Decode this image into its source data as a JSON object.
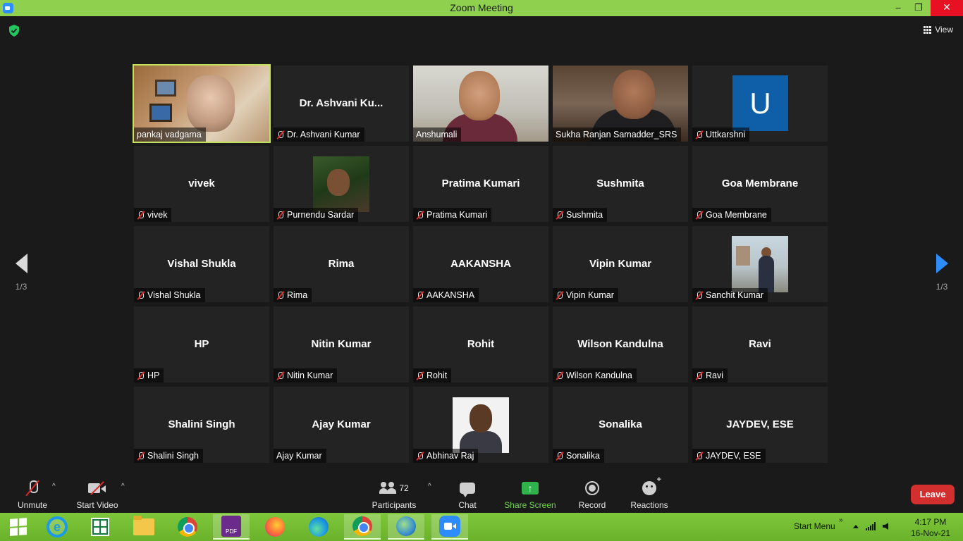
{
  "window": {
    "title": "Zoom Meeting",
    "min_glyph": "–",
    "max_glyph": "❐",
    "close_glyph": "✕",
    "accent": "#8fd14f"
  },
  "topbar": {
    "view_label": "View",
    "shield_color": "#22c55e"
  },
  "pager": {
    "left_page": "1/3",
    "right_page": "1/3"
  },
  "gallery": {
    "tiles": [
      {
        "label": "pankaj vadgama",
        "big": "",
        "muted": false,
        "active": true
      },
      {
        "label": "Dr. Ashvani Kumar",
        "big": "Dr. Ashvani Ku...",
        "muted": true
      },
      {
        "label": "Anshumali",
        "big": "",
        "muted": false
      },
      {
        "label": "Sukha Ranjan Samadder_SRS",
        "big": "",
        "muted": false
      },
      {
        "label": "Uttkarshni",
        "big": "",
        "muted": true,
        "avatar_letter": "U"
      },
      {
        "label": "vivek",
        "big": "vivek",
        "muted": true
      },
      {
        "label": "Purnendu Sardar",
        "big": "",
        "muted": true
      },
      {
        "label": "Pratima Kumari",
        "big": "Pratima Kumari",
        "muted": true
      },
      {
        "label": "Sushmita",
        "big": "Sushmita",
        "muted": true
      },
      {
        "label": "Goa Membrane",
        "big": "Goa Membrane",
        "muted": true
      },
      {
        "label": "Vishal Shukla",
        "big": "Vishal Shukla",
        "muted": true
      },
      {
        "label": "Rima",
        "big": "Rima",
        "muted": true
      },
      {
        "label": "AAKANSHA",
        "big": "AAKANSHA",
        "muted": true
      },
      {
        "label": "Vipin Kumar",
        "big": "Vipin Kumar",
        "muted": true
      },
      {
        "label": "Sanchit Kumar",
        "big": "",
        "muted": true
      },
      {
        "label": "HP",
        "big": "HP",
        "muted": true
      },
      {
        "label": "Nitin Kumar",
        "big": "Nitin Kumar",
        "muted": true
      },
      {
        "label": "Rohit",
        "big": "Rohit",
        "muted": true
      },
      {
        "label": "Wilson Kandulna",
        "big": "Wilson Kandulna",
        "muted": true
      },
      {
        "label": "Ravi",
        "big": "Ravi",
        "muted": true
      },
      {
        "label": "Shalini Singh",
        "big": "Shalini Singh",
        "muted": true
      },
      {
        "label": "Ajay Kumar",
        "big": "Ajay Kumar",
        "muted": false
      },
      {
        "label": "Abhinav Raj",
        "big": "",
        "muted": true
      },
      {
        "label": "Sonalika",
        "big": "Sonalika",
        "muted": true
      },
      {
        "label": "JAYDEV, ESE",
        "big": "JAYDEV, ESE",
        "muted": true
      }
    ]
  },
  "controls": {
    "unmute": "Unmute",
    "start_video": "Start Video",
    "participants": "Participants",
    "participants_count": "72",
    "chat": "Chat",
    "share_screen": "Share Screen",
    "record": "Record",
    "reactions": "Reactions",
    "leave": "Leave",
    "caret": "^",
    "share_color": "#2fb24c",
    "leave_color": "#d32f2f"
  },
  "taskbar": {
    "start_menu": "Start Menu",
    "chevron": "»",
    "pdf_label": "PDF",
    "time": "4:17 PM",
    "date": "16-Nov-21"
  }
}
